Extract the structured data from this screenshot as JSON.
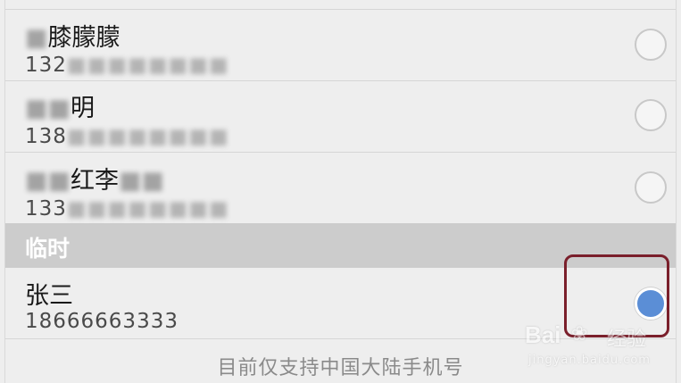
{
  "contacts": [
    {
      "name": "膝朦朦",
      "phone": "132",
      "selected": false
    },
    {
      "name": "明",
      "phone": "138",
      "selected": false
    },
    {
      "name": "红李",
      "phone": "133",
      "selected": false
    }
  ],
  "section": {
    "title": "临时"
  },
  "temp_contact": {
    "name": "张三",
    "phone": "18666663333",
    "selected": true
  },
  "footer": {
    "notice": "目前仅支持中国大陆手机号"
  },
  "watermark": {
    "brand": "Bai",
    "product": "经验",
    "domain": "jingyan.baidu.com"
  },
  "colors": {
    "radio_selected": "#5b8ed6",
    "highlight_border": "#7a1f2b",
    "section_header_bg": "#cccccc"
  }
}
